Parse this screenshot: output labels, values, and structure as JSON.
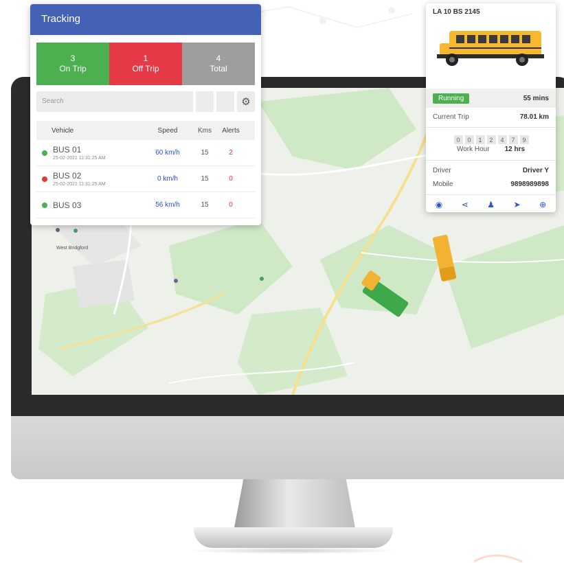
{
  "tracking": {
    "title": "Tracking",
    "stats": [
      {
        "value": "3",
        "label": "On Trip"
      },
      {
        "value": "1",
        "label": "Off Trip"
      },
      {
        "value": "4",
        "label": "Total"
      }
    ],
    "search_placeholder": "Search",
    "columns": {
      "vehicle": "Vehicle",
      "speed": "Speed",
      "kms": "Kms",
      "alerts": "Alerts"
    },
    "rows": [
      {
        "name": "BUS 01",
        "time": "25-02-2021 11:31:25 AM",
        "speed": "60 km/h",
        "kms": "15",
        "alerts": "2",
        "status_color": "#4caf50"
      },
      {
        "name": "BUS 02",
        "time": "25-02-2021 11:31:25 AM",
        "speed": "0 km/h",
        "kms": "15",
        "alerts": "0",
        "status_color": "#e53935"
      },
      {
        "name": "BUS 03",
        "time": "",
        "speed": "56 km/h",
        "kms": "15",
        "alerts": "0",
        "status_color": "#4caf50"
      }
    ]
  },
  "vehicle_card": {
    "plate": "LA 10 BS 2145",
    "status": "Running",
    "duration": "55 mins",
    "current_trip_label": "Current Trip",
    "current_trip_value": "78.01 km",
    "odometer": [
      "0",
      "0",
      "1",
      "2",
      "4",
      "7",
      "9"
    ],
    "work_hour_label": "Work Hour",
    "work_hour_value": "12 hrs",
    "driver_label": "Driver",
    "driver_value": "Driver Y",
    "mobile_label": "Mobile",
    "mobile_value": "9898989898",
    "actions": [
      "eye-icon",
      "share-icon",
      "user-icon",
      "navigate-icon",
      "zoom-icon"
    ]
  },
  "map": {
    "place_label": "West Bridgford"
  },
  "colors": {
    "header_blue": "#4361b5",
    "on_trip": "#4caf50",
    "off_trip": "#e53945",
    "total": "#9e9e9e"
  }
}
